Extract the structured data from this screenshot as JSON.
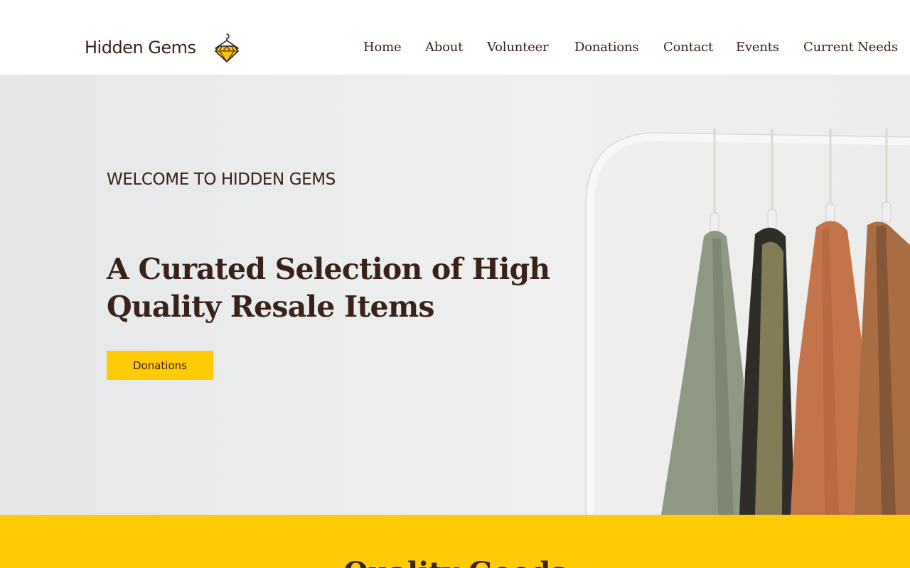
{
  "brand": {
    "name": "Hidden Gems"
  },
  "nav": {
    "items": [
      {
        "label": "Home"
      },
      {
        "label": "About"
      },
      {
        "label": "Volunteer"
      },
      {
        "label": "Donations"
      },
      {
        "label": "Contact"
      },
      {
        "label": "Events"
      },
      {
        "label": "Current Needs"
      }
    ]
  },
  "hero": {
    "eyebrow": "WELCOME TO HIDDEN GEMS",
    "title": "A Curated Selection of High Quality Resale Items",
    "button_label": "Donations"
  },
  "band": {
    "title": "Quality Goods"
  },
  "colors": {
    "accent": "#ffcb05",
    "text": "#3a2218",
    "hero_bg": "#ebebeb"
  }
}
